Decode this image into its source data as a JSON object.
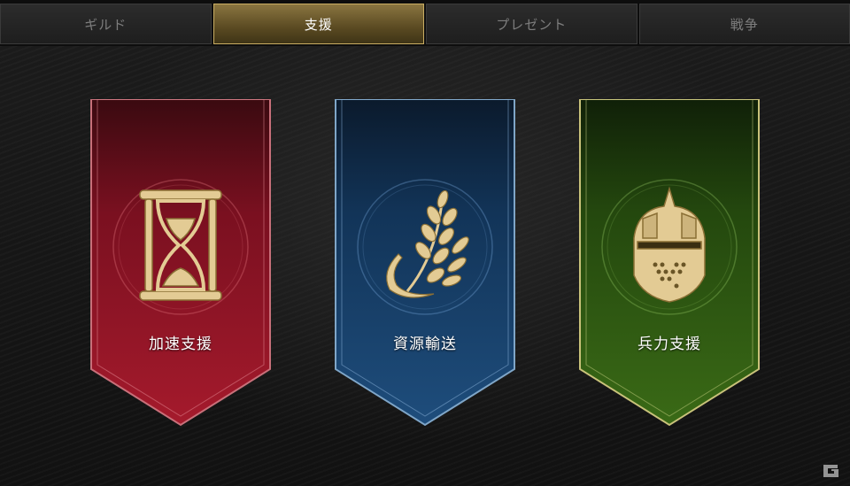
{
  "tabs": [
    {
      "label": "ギルド",
      "active": false
    },
    {
      "label": "支援",
      "active": true
    },
    {
      "label": "プレゼント",
      "active": false
    },
    {
      "label": "戦争",
      "active": false
    }
  ],
  "banners": [
    {
      "label": "加速支援",
      "icon": "hourglass-icon",
      "color": "#8f1424"
    },
    {
      "label": "資源輸送",
      "icon": "wheat-icon",
      "color": "#143e66"
    },
    {
      "label": "兵力支援",
      "icon": "knight-helmet-icon",
      "color": "#2f5a12"
    }
  ],
  "colors": {
    "gold": "#d9c08a",
    "tab_active": "#8a7540"
  }
}
